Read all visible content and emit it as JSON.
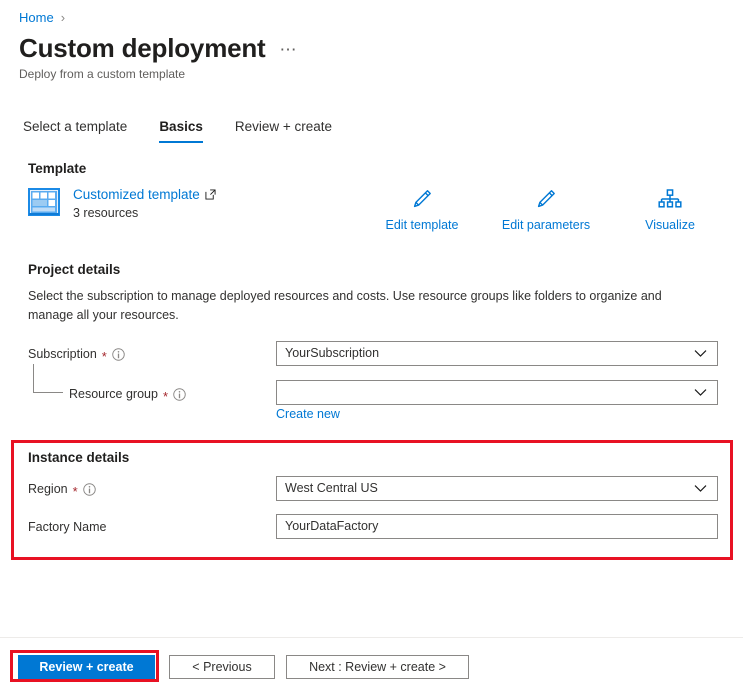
{
  "breadcrumb": {
    "items": [
      {
        "label": "Home",
        "icon": ""
      }
    ],
    "separator": "›"
  },
  "header": {
    "title": "Custom deployment",
    "subtitle": "Deploy from a custom template",
    "more_menu": "⋯"
  },
  "tabs": [
    {
      "label": "Select a template",
      "active": false
    },
    {
      "label": "Basics",
      "active": true
    },
    {
      "label": "Review + create",
      "active": false
    }
  ],
  "template_section": {
    "heading": "Template",
    "link_label": "Customized template",
    "link_icon": "external-link-icon",
    "resource_count": "3 resources",
    "card_icon": "template-grid-icon",
    "actions": [
      {
        "label": "Edit template",
        "icon": "pencil-icon"
      },
      {
        "label": "Edit parameters",
        "icon": "pencil-icon"
      },
      {
        "label": "Visualize",
        "icon": "hierarchy-icon"
      }
    ]
  },
  "project_details": {
    "heading": "Project details",
    "description": "Select the subscription to manage deployed resources and costs. Use resource groups like folders to organize and manage all your resources.",
    "fields": [
      {
        "label": "Subscription",
        "required": "*",
        "info": "ⓘ",
        "value": "YourSubscription",
        "type": "dropdown"
      },
      {
        "label": "Resource group",
        "required": "*",
        "info": "ⓘ",
        "value": "",
        "type": "dropdown"
      }
    ],
    "create_new_label": "Create new"
  },
  "instance_details": {
    "heading": "Instance details",
    "highlighted": true,
    "fields": [
      {
        "label": "Region",
        "required": "*",
        "info": "ⓘ",
        "value": "West Central US",
        "type": "dropdown"
      },
      {
        "label": "Factory Name",
        "required": "",
        "info": "",
        "value": "YourDataFactory",
        "type": "text"
      }
    ]
  },
  "footer": {
    "primary_button": "Review + create",
    "previous_button": "< Previous",
    "next_button": "Next : Review + create >",
    "primary_highlighted": true
  },
  "colors": {
    "accent": "#0078d4",
    "link": "#0078d4",
    "highlight": "#e81123",
    "required": "#a4262c",
    "text": "#323130",
    "border": "#8a8886"
  }
}
